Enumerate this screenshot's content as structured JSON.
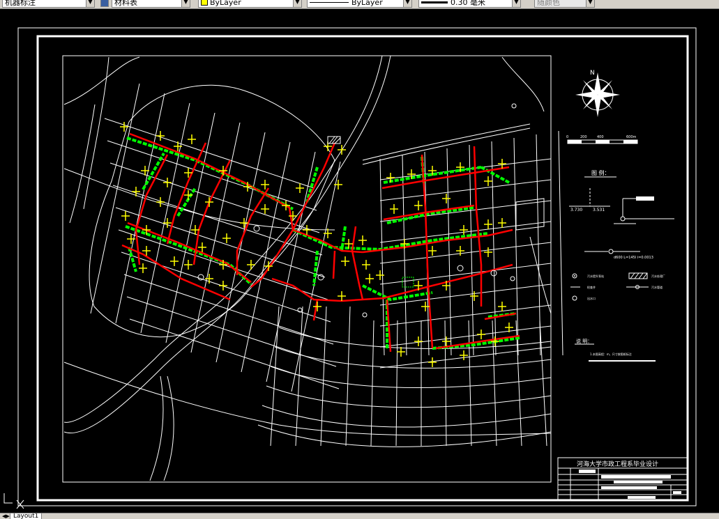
{
  "toolbar": {
    "dimstyle": "机器标注",
    "layer": "材料表",
    "color": "ByLayer",
    "linetype": "ByLayer",
    "lineweight": "0.30 毫米",
    "plotstyle": "随颜色"
  },
  "drawing": {
    "north": "N",
    "scale_labels": [
      "0",
      "200",
      "400",
      "600m"
    ],
    "legend_title": "图 例：",
    "elev_1": "3.730",
    "elev_2": "3.531",
    "pipe_label": "d600 L=145l i=0.0013",
    "legend_items": [
      "污水提升泵站",
      "污水处理厂",
      "检查井",
      "污水管道",
      "出水口"
    ],
    "notes_title": "说 明：",
    "note_1": "1.本图高程：m，尺寸按图纸标注",
    "title_block": "河海大学市政工程系毕业设计"
  },
  "colors": {
    "background": "#000000",
    "road": "#ffffff",
    "sewer": "#ff0000",
    "green_belt": "#00ff00",
    "symbol": "#ffff00"
  },
  "tabs": {
    "layout1": "Layout1"
  }
}
